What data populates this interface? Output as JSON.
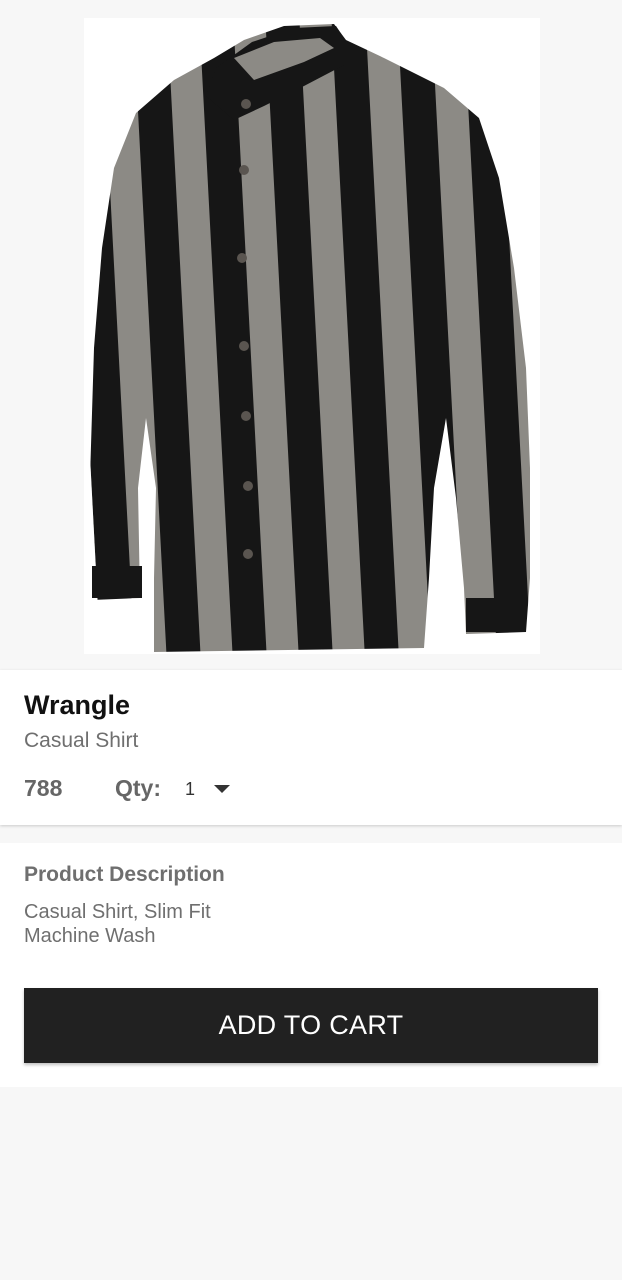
{
  "product": {
    "image_alt": "striped-shirt-image",
    "brand": "Wrangle",
    "category": "Casual Shirt",
    "price": "788",
    "quantity_label": "Qty:",
    "quantity_value": "1"
  },
  "description": {
    "title": "Product Description",
    "lines": [
      "Casual Shirt, Slim Fit",
      "Machine Wash"
    ]
  },
  "actions": {
    "add_to_cart_label": "ADD TO CART"
  },
  "colors": {
    "button_background": "#212121",
    "stripe_dark": "#161616",
    "stripe_light": "#8c8a85"
  }
}
